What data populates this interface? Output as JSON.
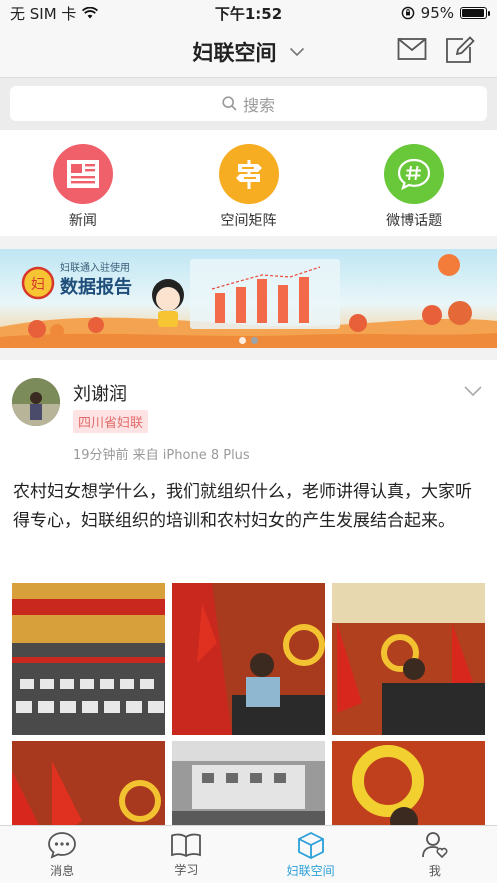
{
  "status_bar": {
    "carrier": "无 SIM 卡",
    "time": "下午1:52",
    "battery": "95%",
    "battery_level": 0.95
  },
  "nav": {
    "title": "妇联空间"
  },
  "search": {
    "placeholder": "搜索"
  },
  "quick_menu": [
    {
      "label": "新闻",
      "icon": "newspaper-icon",
      "color": "#f0606a"
    },
    {
      "label": "空间矩阵",
      "icon": "signpost-icon",
      "color": "#f7ad22"
    },
    {
      "label": "微博话题",
      "icon": "hashtag-chat-icon",
      "color": "#69c73a"
    }
  ],
  "banner": {
    "tag": "妇联通入驻使用",
    "title": "数据报告"
  },
  "post": {
    "author": "刘谢润",
    "org": "四川省妇联",
    "meta": "19分钟前 来自 iPhone 8 Plus",
    "text": "农村妇女想学什么，我们就组织什么，老师讲得认真，大家听得专心，妇联组织的培训和农村妇女的产生发展结合起来。"
  },
  "tabs": [
    {
      "label": "消息",
      "icon": "chat-bubble-icon",
      "active": false
    },
    {
      "label": "学习",
      "icon": "book-icon",
      "active": false
    },
    {
      "label": "妇联空间",
      "icon": "cube-icon",
      "active": true
    },
    {
      "label": "我",
      "icon": "person-heart-icon",
      "active": false
    }
  ],
  "colors": {
    "accent": "#2a9fd8",
    "badge_bg": "#fde3e3",
    "badge_text": "#e26b6b"
  }
}
